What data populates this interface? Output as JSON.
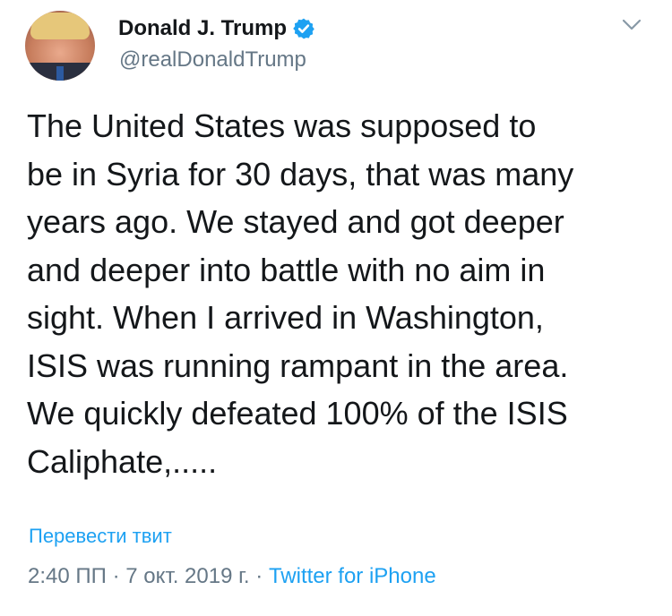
{
  "user": {
    "display_name": "Donald J. Trump",
    "handle": "@realDonaldTrump"
  },
  "icons": {
    "avatar": "profile-photo",
    "verified": "verified-badge-icon",
    "menu": "chevron-down-icon"
  },
  "colors": {
    "link": "#1da1f2",
    "secondary_text": "#657786",
    "primary_text": "#14171a"
  },
  "tweet": {
    "lines": [
      "The United States was supposed to",
      "be in Syria for 30 days, that was many",
      "years ago. We stayed and got deeper",
      "and deeper into battle with no aim in",
      "sight. When I arrived in Washington,",
      "ISIS was running rampant in the area.",
      "We quickly defeated 100% of the ISIS",
      "Caliphate,....."
    ],
    "translate_label": "Перевести твит",
    "time": "2:40 ПП",
    "separator": "·",
    "date": "7 окт. 2019 г.",
    "source": "Twitter for iPhone"
  }
}
